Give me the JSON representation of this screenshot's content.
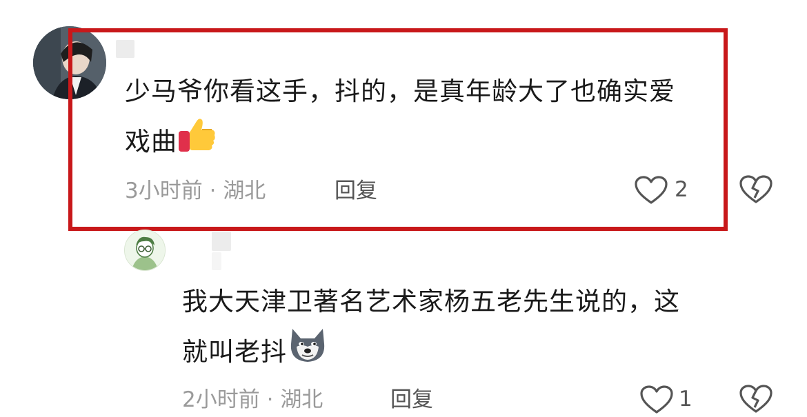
{
  "comments": [
    {
      "text_line1": "少马爷你看这手，抖的，是真年龄大了也确实爱",
      "text_line2": "戏曲",
      "emoji": "thumbs-up",
      "time": "3小时前",
      "separator": "·",
      "location": "湖北",
      "reply_label": "回复",
      "like_count": "2"
    },
    {
      "text_line1": "我大天津卫著名艺术家杨五老先生说的，这",
      "text_line2": "就叫老抖",
      "emoji": "dog-face",
      "time": "2小时前",
      "separator": "·",
      "location": "湖北",
      "reply_label": "回复",
      "like_count": "1"
    }
  ],
  "colors": {
    "highlight_border": "#c8181a",
    "meta_text": "#9a9a9a",
    "body_text": "#1a1a1a"
  }
}
